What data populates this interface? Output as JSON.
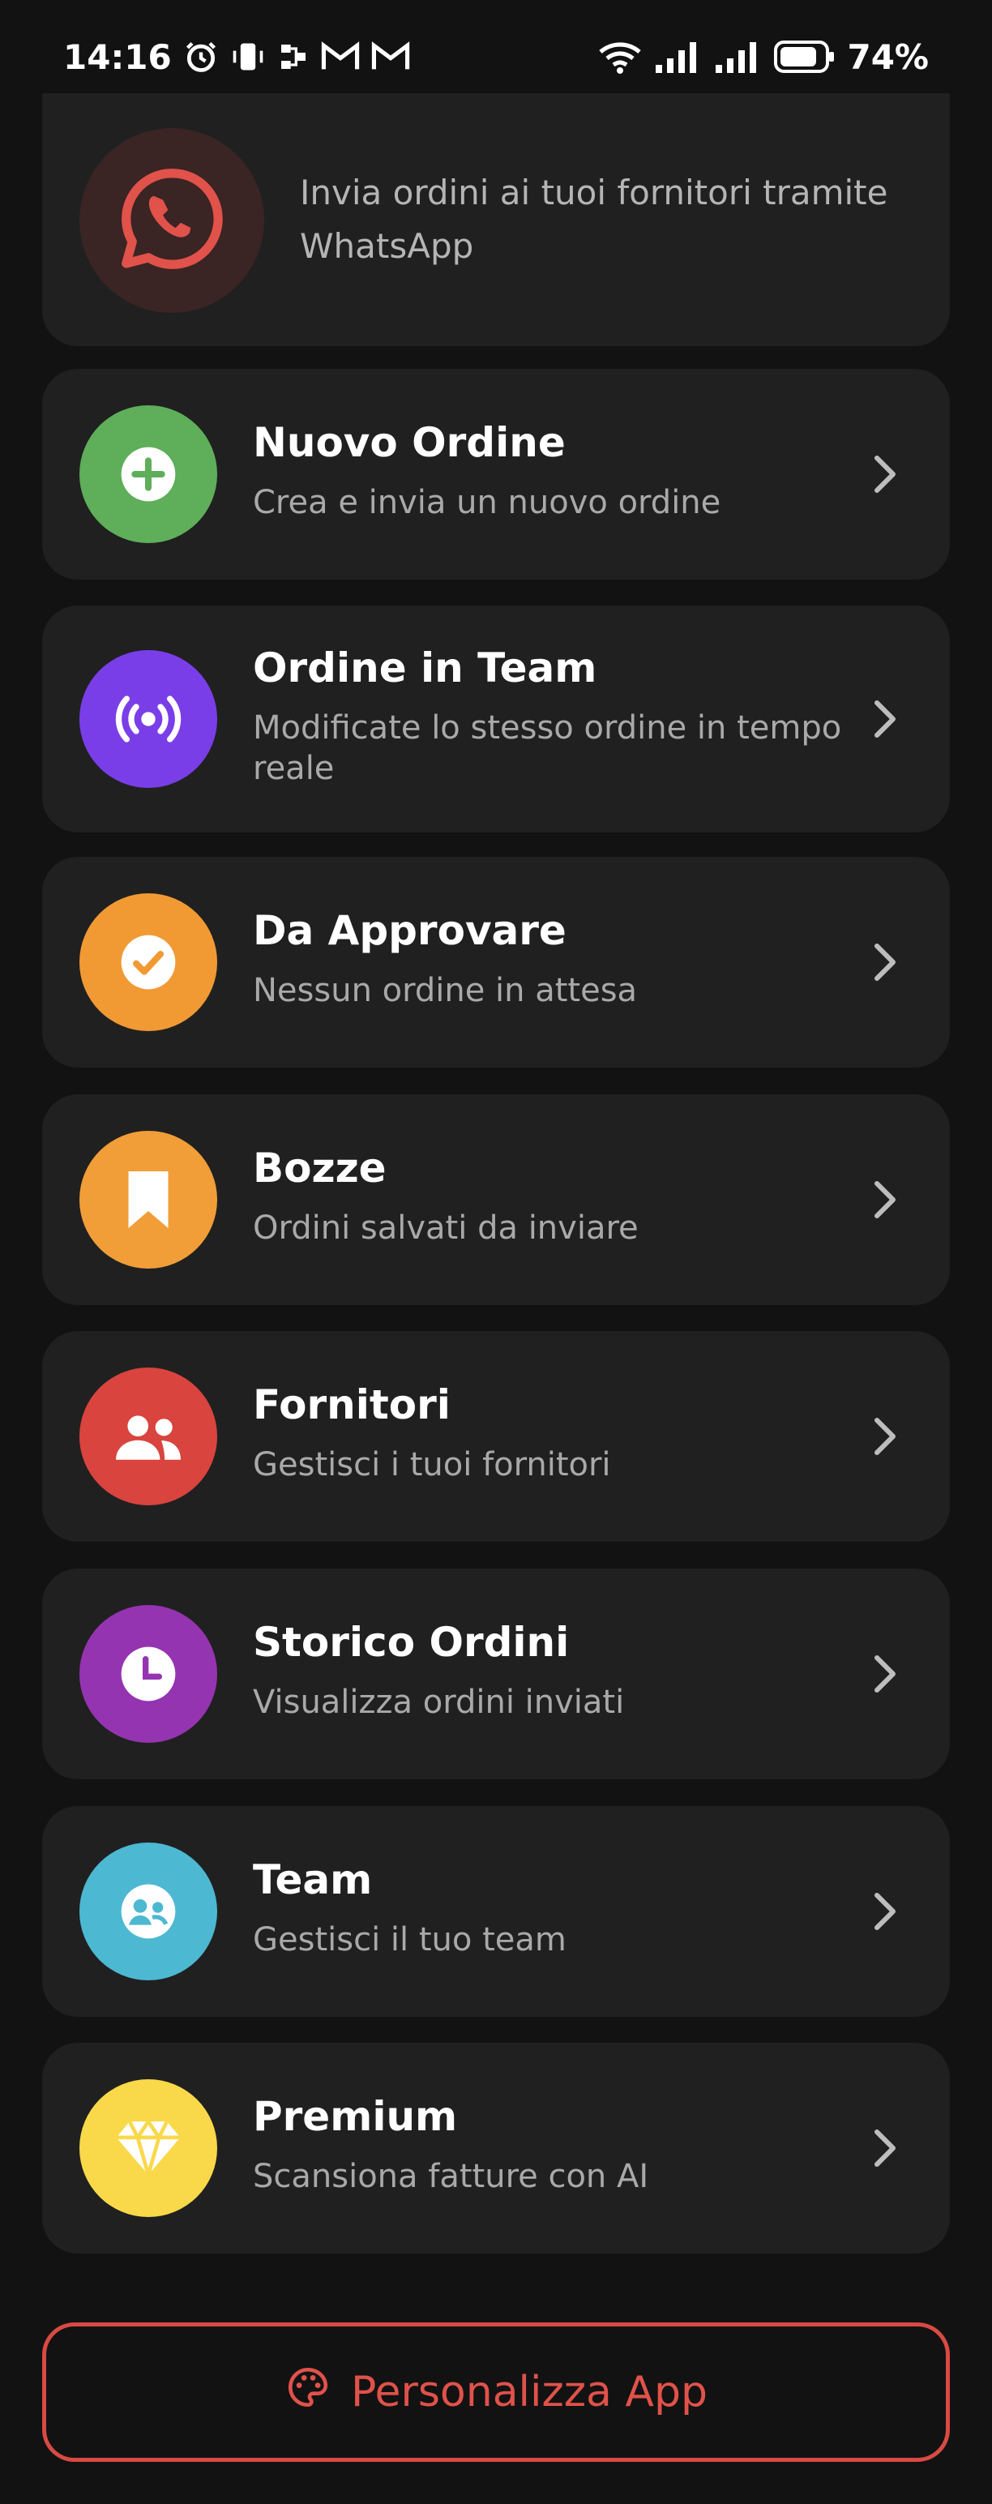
{
  "status_bar": {
    "time": "14:16",
    "battery": "74%"
  },
  "header_card": {
    "description": "Invia ordini ai tuoi fornitori tramite WhatsApp"
  },
  "menu": [
    {
      "title": "Nuovo Ordine",
      "subtitle": "Crea e invia un nuovo ordine",
      "color": "#5fae5a",
      "icon": "plus-circle-icon"
    },
    {
      "title": "Ordine in Team",
      "subtitle": "Modificate lo stesso ordine in tempo reale",
      "color": "#7a3ee8",
      "icon": "broadcast-icon"
    },
    {
      "title": "Da Approvare",
      "subtitle": "Nessun ordine in attesa",
      "color": "#f19a34",
      "icon": "check-circle-icon"
    },
    {
      "title": "Bozze",
      "subtitle": "Ordini salvati da inviare",
      "color": "#f19e38",
      "icon": "bookmark-icon"
    },
    {
      "title": "Fornitori",
      "subtitle": "Gestisci i tuoi fornitori",
      "color": "#d9443e",
      "icon": "people-icon"
    },
    {
      "title": "Storico Ordini",
      "subtitle": "Visualizza ordini inviati",
      "color": "#9534b0",
      "icon": "clock-icon"
    },
    {
      "title": "Team",
      "subtitle": "Gestisci il tuo team",
      "color": "#4db8d2",
      "icon": "team-icon"
    },
    {
      "title": "Premium",
      "subtitle": "Scansiona fatture con AI",
      "color": "#f9d949",
      "icon": "diamond-icon"
    }
  ],
  "personalize_button": {
    "label": "Personalizza App",
    "color": "#d94a42"
  }
}
